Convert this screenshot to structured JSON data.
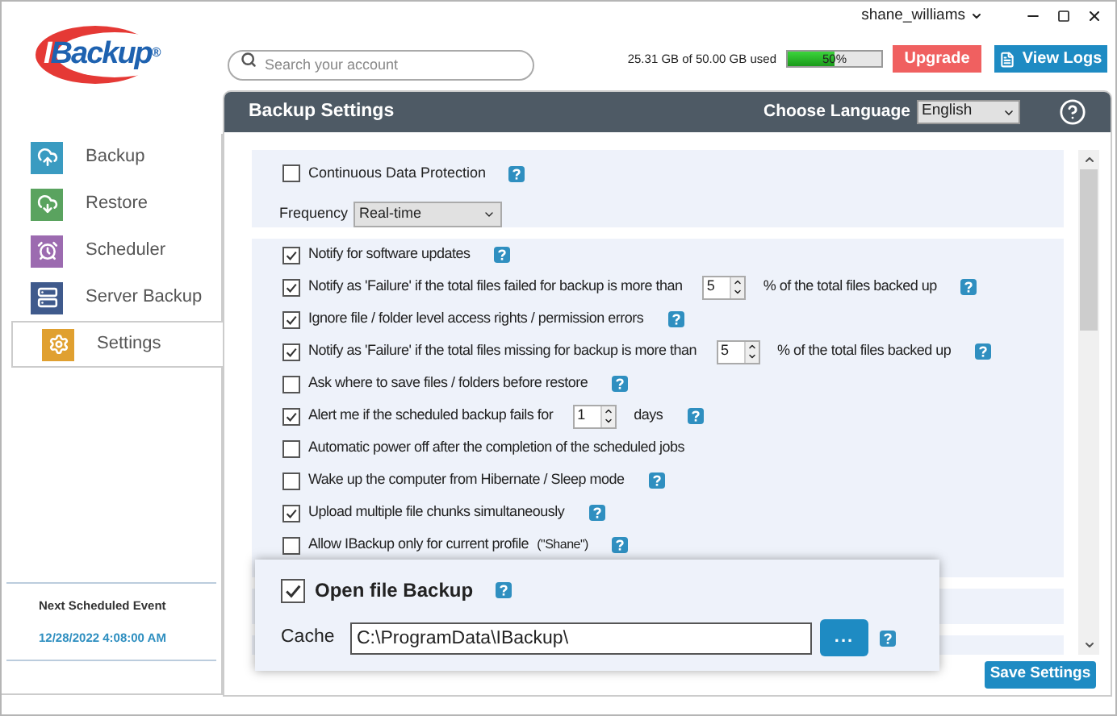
{
  "window": {
    "user": "shane_williams"
  },
  "logo": {
    "text": "IBackup",
    "mark": "®"
  },
  "search": {
    "placeholder": "Search your account"
  },
  "storage": {
    "usage": "25.31 GB of 50.00 GB used",
    "level": 0.5,
    "percent": "50%"
  },
  "buttons": {
    "upgrade": "Upgrade",
    "view_logs": "View Logs"
  },
  "sidebar": {
    "items": [
      {
        "label": "Backup",
        "kind": "backup",
        "selected": false
      },
      {
        "label": "Restore",
        "kind": "restore",
        "selected": false
      },
      {
        "label": "Scheduler",
        "kind": "scheduler",
        "selected": false
      },
      {
        "label": "Server Backup",
        "kind": "server",
        "selected": false
      },
      {
        "label": "Settings",
        "kind": "settings",
        "selected": true
      }
    ],
    "next_event": {
      "title": "Next Scheduled Event",
      "time": "12/28/2022 4:08:00 AM"
    }
  },
  "panel": {
    "title": "Backup Settings",
    "language_label": "Choose Language",
    "language": "English",
    "cdp": {
      "label": "Continuous Data Protection",
      "checked": false,
      "help": true,
      "frequency_label": "Frequency",
      "frequency": "Real-time"
    },
    "options": [
      {
        "kind": "check",
        "label": "Notify for software updates",
        "checked": true,
        "help": true
      },
      {
        "kind": "spin",
        "label": "Notify as 'Failure' if the total files failed for backup is more than",
        "value": "5",
        "suffix": "% of the total files backed up",
        "checked": true,
        "help": true
      },
      {
        "kind": "check",
        "label": "Ignore file / folder level access rights / permission errors",
        "checked": true,
        "help": true
      },
      {
        "kind": "spin",
        "label": "Notify as 'Failure' if the total files missing for backup is more than",
        "value": "5",
        "suffix": "% of the total files backed up",
        "checked": true,
        "help": true
      },
      {
        "kind": "check",
        "label": "Ask where to save files / folders before restore",
        "checked": false,
        "help": true
      },
      {
        "kind": "spin",
        "label": "Alert me if the scheduled backup fails for",
        "value": "1",
        "suffix": "days",
        "checked": true,
        "help": true
      },
      {
        "kind": "check",
        "label": "Automatic power off after the completion of the scheduled jobs",
        "checked": false,
        "help": false
      },
      {
        "kind": "check",
        "label": "Wake up the computer from Hibernate / Sleep mode",
        "checked": false,
        "help": true
      },
      {
        "kind": "check",
        "label": "Upload multiple file chunks simultaneously",
        "checked": true,
        "help": true
      },
      {
        "kind": "check",
        "label": "Allow IBackup only for current profile",
        "note": "(\"Shane\")",
        "checked": false,
        "help": true
      }
    ],
    "open_file": {
      "label": "Open file Backup",
      "checked": true,
      "help": true,
      "cache_label": "Cache",
      "cache_path": "C:\\ProgramData\\IBackup\\",
      "browse": "..."
    },
    "save": "Save Settings"
  }
}
